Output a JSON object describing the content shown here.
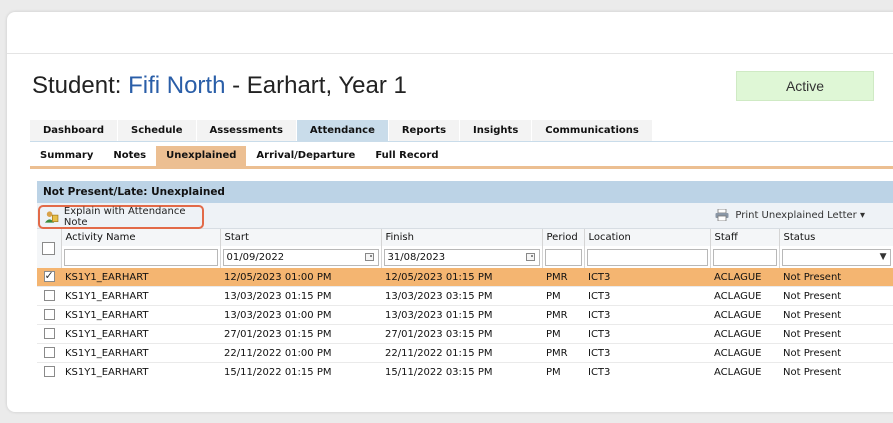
{
  "student": {
    "prefix": "Student: ",
    "name": "Fifi North",
    "suffix": " - Earhart, Year 1",
    "status": "Active"
  },
  "colors": {
    "accent_blue": "#2a5ea8",
    "tab_active": "#c9dcea",
    "subtab_active": "#ecbf92",
    "selected_row": "#f4b571",
    "status_bg": "#dff7d6",
    "highlight_border": "#e26a48"
  },
  "tabs": [
    {
      "label": "Dashboard"
    },
    {
      "label": "Schedule"
    },
    {
      "label": "Assessments"
    },
    {
      "label": "Attendance",
      "active": true
    },
    {
      "label": "Reports"
    },
    {
      "label": "Insights"
    },
    {
      "label": "Communications"
    }
  ],
  "subtabs": [
    {
      "label": "Summary"
    },
    {
      "label": "Notes"
    },
    {
      "label": "Unexplained",
      "active": true
    },
    {
      "label": "Arrival/Departure"
    },
    {
      "label": "Full Record"
    }
  ],
  "panel": {
    "title": "Not Present/Late: Unexplained",
    "explain_button": "Explain with Attendance Note",
    "explain_icon": "user-note-icon",
    "print_button": "Print Unexplained Letter ▾",
    "print_icon": "printer-icon"
  },
  "table": {
    "columns": [
      "Activity Name",
      "Start",
      "Finish",
      "Period",
      "Location",
      "Staff",
      "Status"
    ],
    "filters": {
      "start": "01/09/2022",
      "finish": "31/08/2023"
    },
    "rows": [
      {
        "checked": true,
        "activity": "KS1Y1_EARHART",
        "start": "12/05/2023 01:00 PM",
        "finish": "12/05/2023 01:15 PM",
        "period": "PMR",
        "location": "ICT3",
        "staff": "ACLAGUE",
        "status": "Not Present"
      },
      {
        "checked": false,
        "activity": "KS1Y1_EARHART",
        "start": "13/03/2023 01:15 PM",
        "finish": "13/03/2023 03:15 PM",
        "period": "PM",
        "location": "ICT3",
        "staff": "ACLAGUE",
        "status": "Not Present"
      },
      {
        "checked": false,
        "activity": "KS1Y1_EARHART",
        "start": "13/03/2023 01:00 PM",
        "finish": "13/03/2023 01:15 PM",
        "period": "PMR",
        "location": "ICT3",
        "staff": "ACLAGUE",
        "status": "Not Present"
      },
      {
        "checked": false,
        "activity": "KS1Y1_EARHART",
        "start": "27/01/2023 01:15 PM",
        "finish": "27/01/2023 03:15 PM",
        "period": "PM",
        "location": "ICT3",
        "staff": "ACLAGUE",
        "status": "Not Present"
      },
      {
        "checked": false,
        "activity": "KS1Y1_EARHART",
        "start": "22/11/2022 01:00 PM",
        "finish": "22/11/2022 01:15 PM",
        "period": "PMR",
        "location": "ICT3",
        "staff": "ACLAGUE",
        "status": "Not Present"
      },
      {
        "checked": false,
        "activity": "KS1Y1_EARHART",
        "start": "15/11/2022 01:15 PM",
        "finish": "15/11/2022 03:15 PM",
        "period": "PM",
        "location": "ICT3",
        "staff": "ACLAGUE",
        "status": "Not Present"
      }
    ]
  }
}
